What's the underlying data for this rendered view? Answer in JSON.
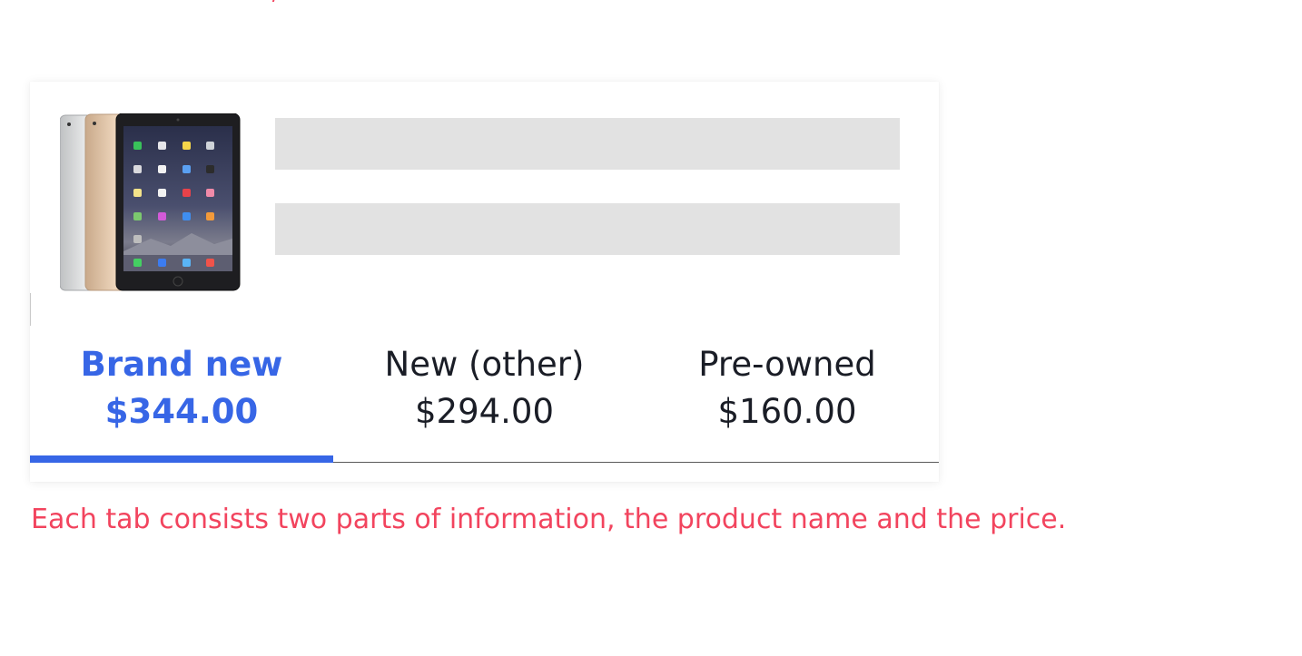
{
  "product": {
    "image_alt": "iPad Air 2 in silver, gold and space gray"
  },
  "tabs": [
    {
      "label": "Brand new",
      "price": "$344.00",
      "selected": true
    },
    {
      "label": "New (other)",
      "price": "$294.00",
      "selected": false
    },
    {
      "label": "Pre-owned",
      "price": "$160.00",
      "selected": false
    }
  ],
  "caption": "Each tab consists two parts of information, the product name and the price.",
  "colors": {
    "accent": "#3766e6",
    "annotation": "#f2445e",
    "skeleton": "#e2e2e2",
    "text": "#1a1d26"
  }
}
